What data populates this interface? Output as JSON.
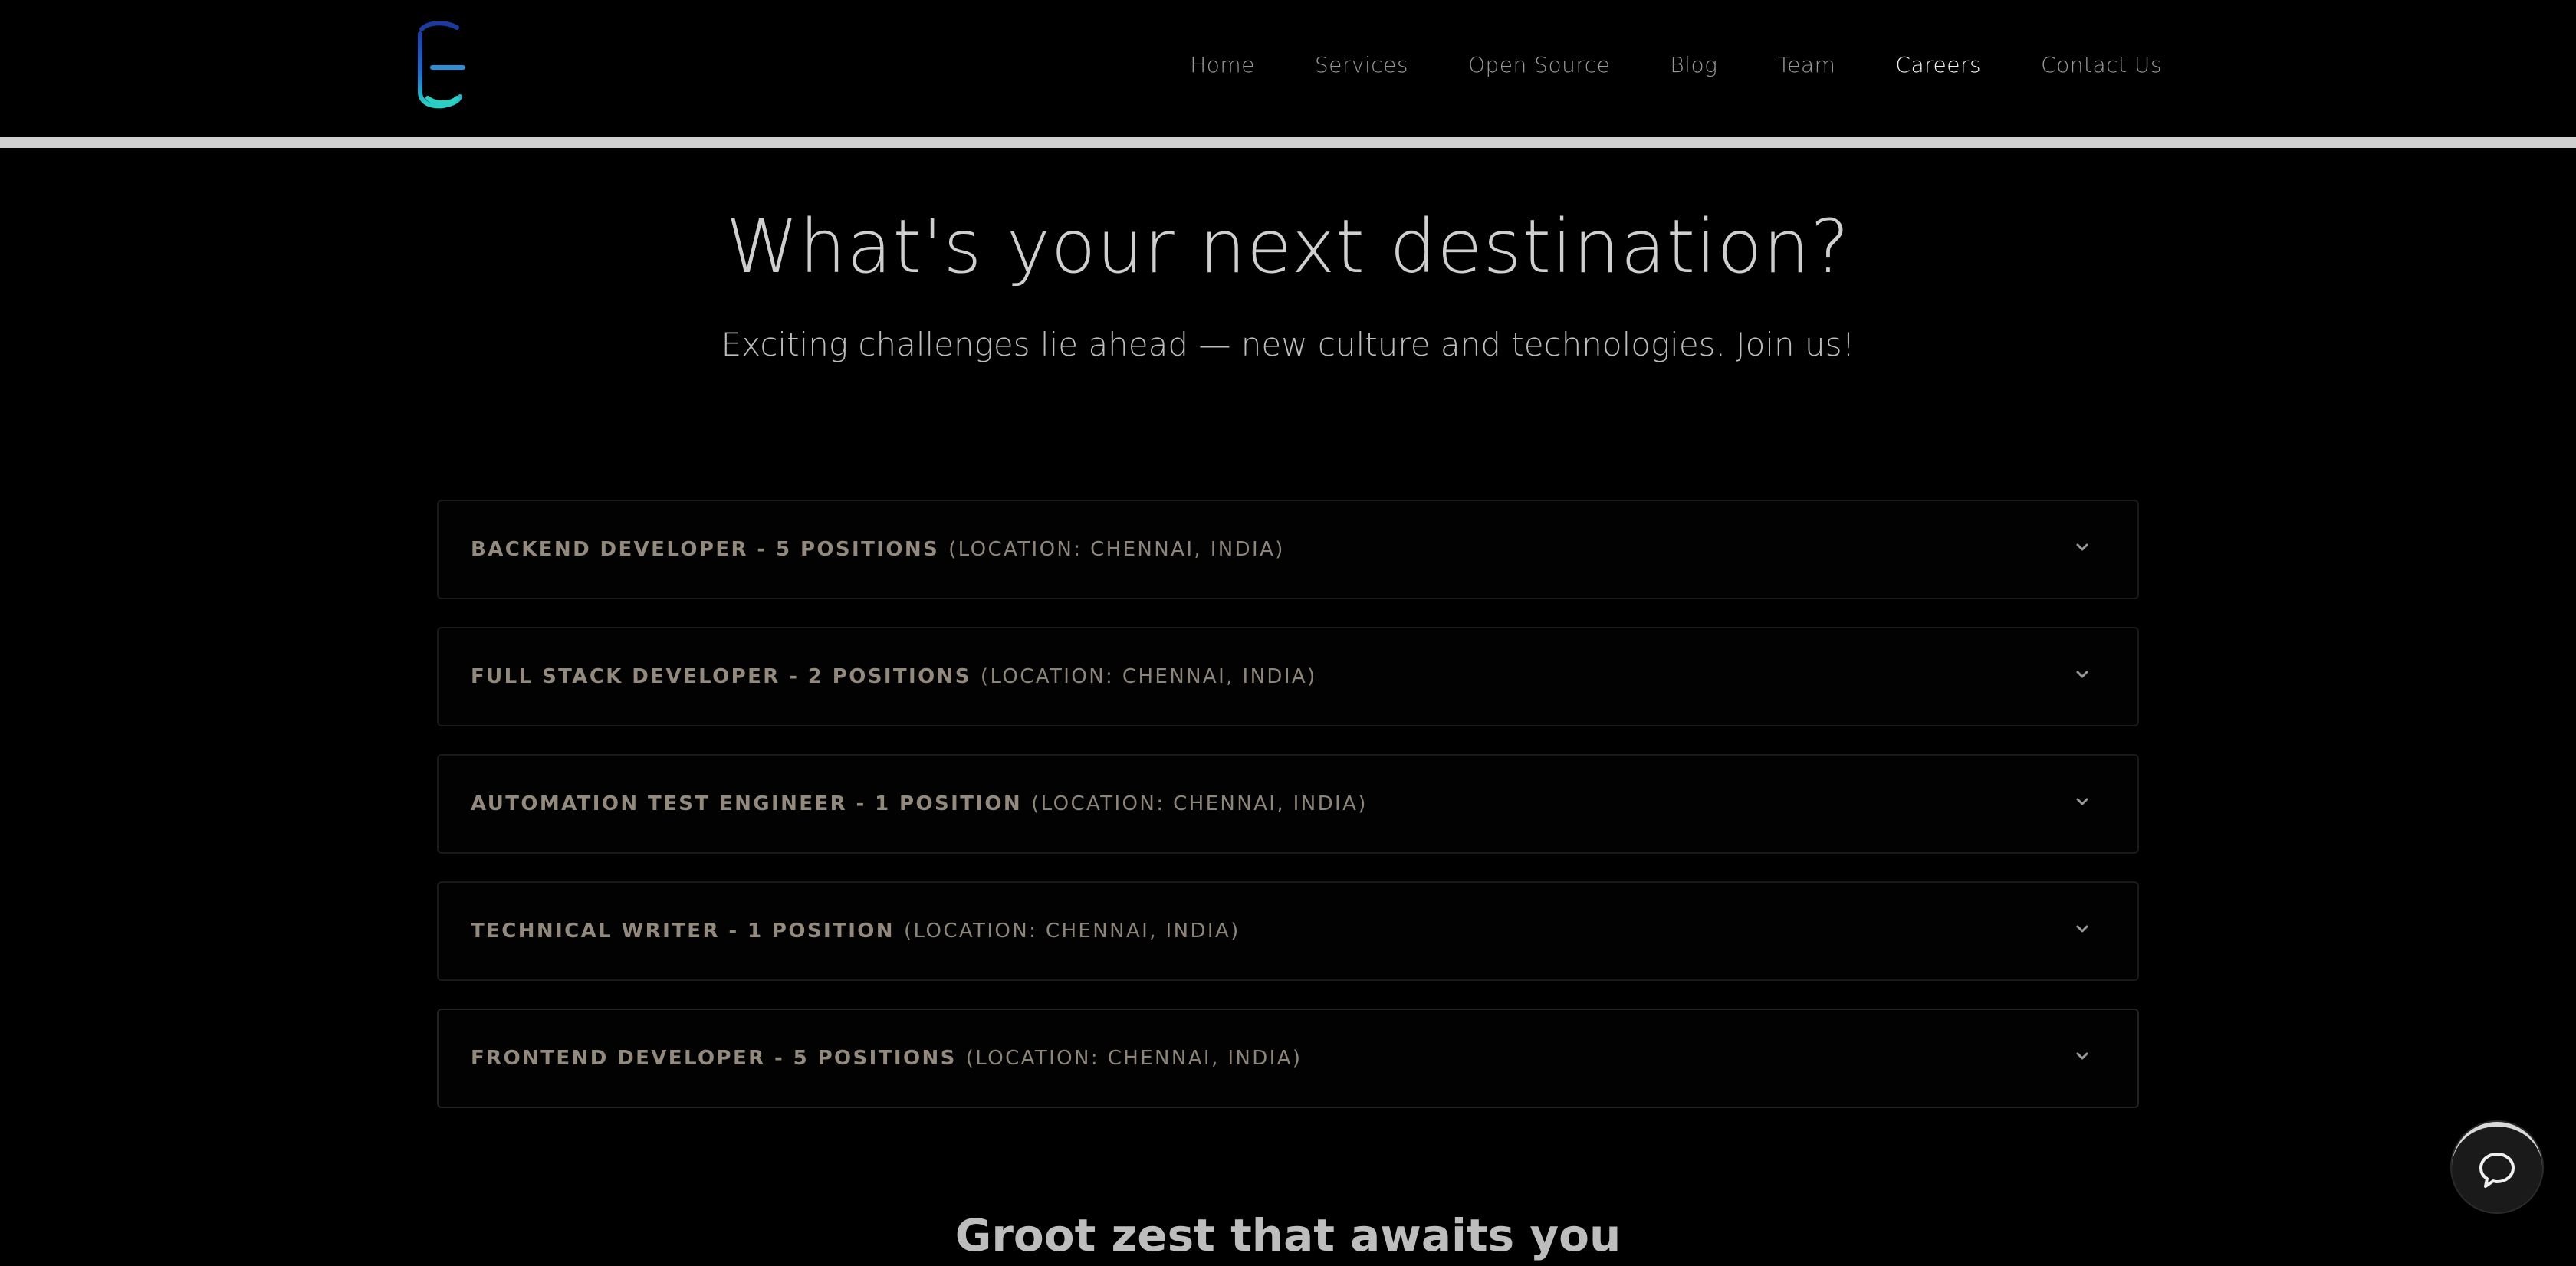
{
  "nav": {
    "items": [
      {
        "label": "Home",
        "active": false
      },
      {
        "label": "Services",
        "active": false
      },
      {
        "label": "Open Source",
        "active": false
      },
      {
        "label": "Blog",
        "active": false
      },
      {
        "label": "Team",
        "active": false
      },
      {
        "label": "Careers",
        "active": true
      },
      {
        "label": "Contact Us",
        "active": false
      }
    ]
  },
  "hero": {
    "title": "What's your next destination?",
    "subtitle": "Exciting challenges lie ahead — new culture and technologies. Join us!"
  },
  "jobs": [
    {
      "role": "BACKEND DEVELOPER - 5 POSITIONS",
      "location": "(LOCATION: CHENNAI, INDIA)"
    },
    {
      "role": "FULL STACK DEVELOPER - 2 POSITIONS",
      "location": "(LOCATION: CHENNAI, INDIA)"
    },
    {
      "role": "AUTOMATION TEST ENGINEER - 1 POSITION",
      "location": "(LOCATION: CHENNAI, INDIA)"
    },
    {
      "role": "TECHNICAL WRITER - 1 POSITION",
      "location": "(LOCATION: CHENNAI, INDIA)"
    },
    {
      "role": "FRONTEND DEVELOPER - 5 POSITIONS",
      "location": "(LOCATION: CHENNAI, INDIA)"
    }
  ],
  "section": {
    "heading": "Groot zest that awaits you"
  },
  "icons": {
    "logo": "brand-logo-icon",
    "chevron": "chevron-down-icon",
    "chat": "chat-bubble-icon"
  },
  "colors": {
    "background": "#000000",
    "logo_blue": "#1e5bd6",
    "logo_teal": "#2ad1c4",
    "header_rule": "#cfcfcf",
    "job_text": "#938a7d"
  }
}
